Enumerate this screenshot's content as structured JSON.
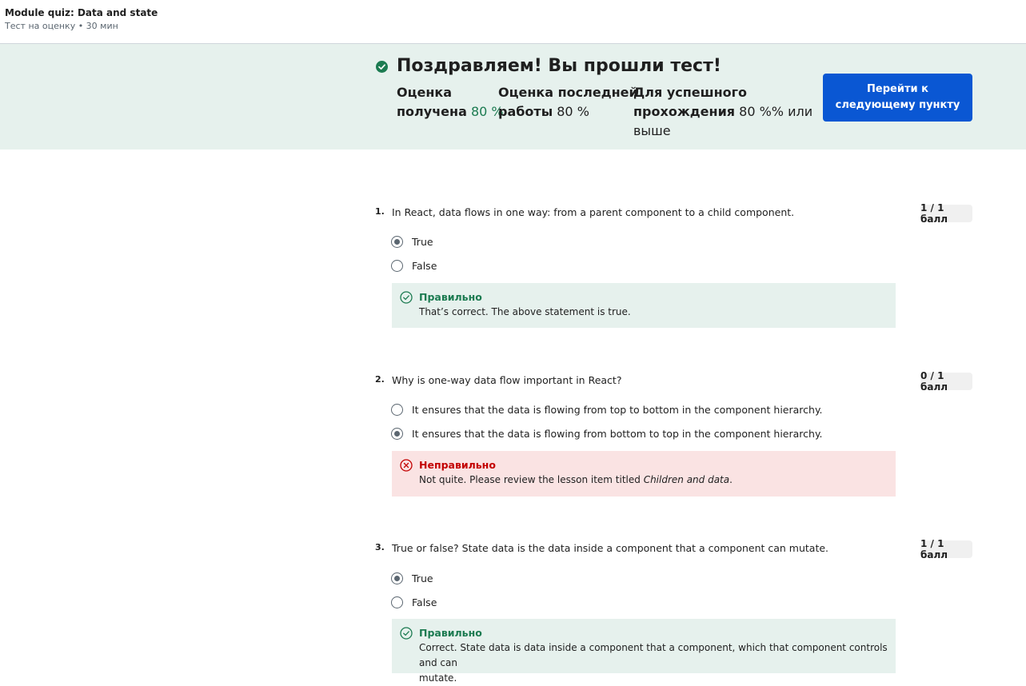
{
  "header": {
    "title": "Module quiz: Data and state",
    "subtitle": "Тест на оценку • 30 мин"
  },
  "banner": {
    "headline": "Поздравляем! Вы прошли тест!",
    "stats": [
      {
        "label_line1": "Оценка",
        "label_line2": "получена",
        "value": "80 %"
      },
      {
        "label_line1": "Оценка последней",
        "label_line2": "работы",
        "value": "80 %"
      },
      {
        "label_line1": "Для успешного",
        "label_line2": "прохождения",
        "value": "80 %% или",
        "label_line3": "выше"
      }
    ],
    "next_button_line1": "Перейти к",
    "next_button_line2": "следующему пункту"
  },
  "colors": {
    "accent": "#0a57d3",
    "correct": "#1c7b51",
    "incorrect": "#c30000",
    "banner_bg": "#e6f1ed"
  },
  "questions": [
    {
      "number": "1.",
      "text": "In React, data flows in one way: from a parent component to a child component.",
      "score": "1 / 1 балл",
      "options": [
        {
          "label": "True",
          "selected": true
        },
        {
          "label": "False",
          "selected": false
        }
      ],
      "feedback": {
        "status": "correct",
        "icon": "check-circle-icon",
        "title": "Правильно",
        "text": "That’s correct. The above statement is true."
      }
    },
    {
      "number": "2.",
      "text": "Why is one-way data flow important in React?",
      "score": "0 / 1 балл",
      "options": [
        {
          "label": "It ensures that the data is flowing from top to bottom in the component hierarchy.",
          "selected": false
        },
        {
          "label": "It ensures that the data is flowing from bottom to top in the component hierarchy.",
          "selected": true
        }
      ],
      "feedback": {
        "status": "incorrect",
        "icon": "x-circle-icon",
        "title": "Неправильно",
        "text": "Not quite. Please review the lesson item titled ",
        "text_italic": "Children and data",
        "text_end": "."
      }
    },
    {
      "number": "3.",
      "text": "True or false? State data is the data inside a component that a component can mutate.",
      "score": "1 / 1 балл",
      "options": [
        {
          "label": "True",
          "selected": true
        },
        {
          "label": "False",
          "selected": false
        }
      ],
      "feedback": {
        "status": "correct",
        "icon": "check-circle-icon",
        "title": "Правильно",
        "text_line1": "Correct. State data is data inside a component that a component, which that component controls and can",
        "text_line2": "mutate."
      }
    }
  ]
}
